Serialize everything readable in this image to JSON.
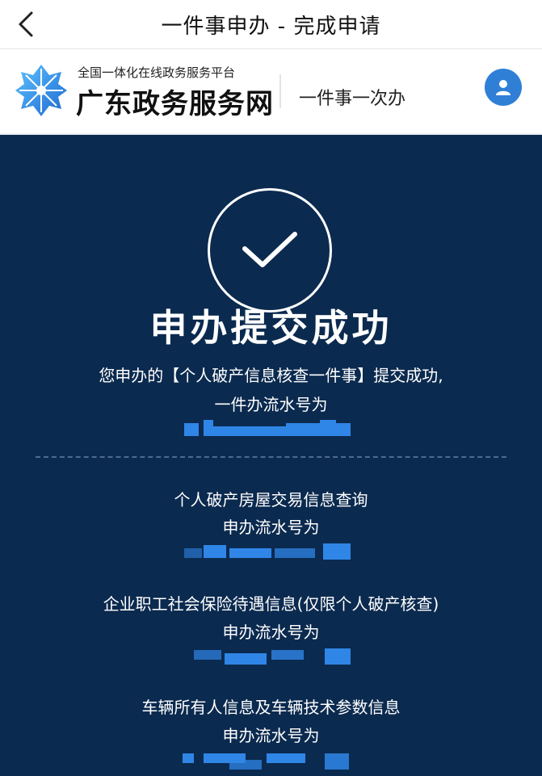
{
  "topbar": {
    "title": "一件事申办 - 完成申请"
  },
  "brand": {
    "subtitle": "全国一体化在线政务服务平台",
    "name": "广东政务服务网",
    "slogan": "一件事一次办"
  },
  "result": {
    "title": "申办提交成功",
    "line1": "您申办的【个人破产信息核查一件事】提交成功,",
    "line2": "一件办流水号为"
  },
  "items": [
    {
      "title": "个人破产房屋交易信息查询",
      "label": "申办流水号为"
    },
    {
      "title": "企业职工社会保险待遇信息(仅限个人破产核查)",
      "label": "申办流水号为"
    },
    {
      "title": "车辆所有人信息及车辆技术参数信息",
      "label": "申办流水号为"
    }
  ],
  "colors": {
    "background": "#0b2a4f",
    "accent": "#2f7fd6",
    "mask": "#2f86e7"
  }
}
